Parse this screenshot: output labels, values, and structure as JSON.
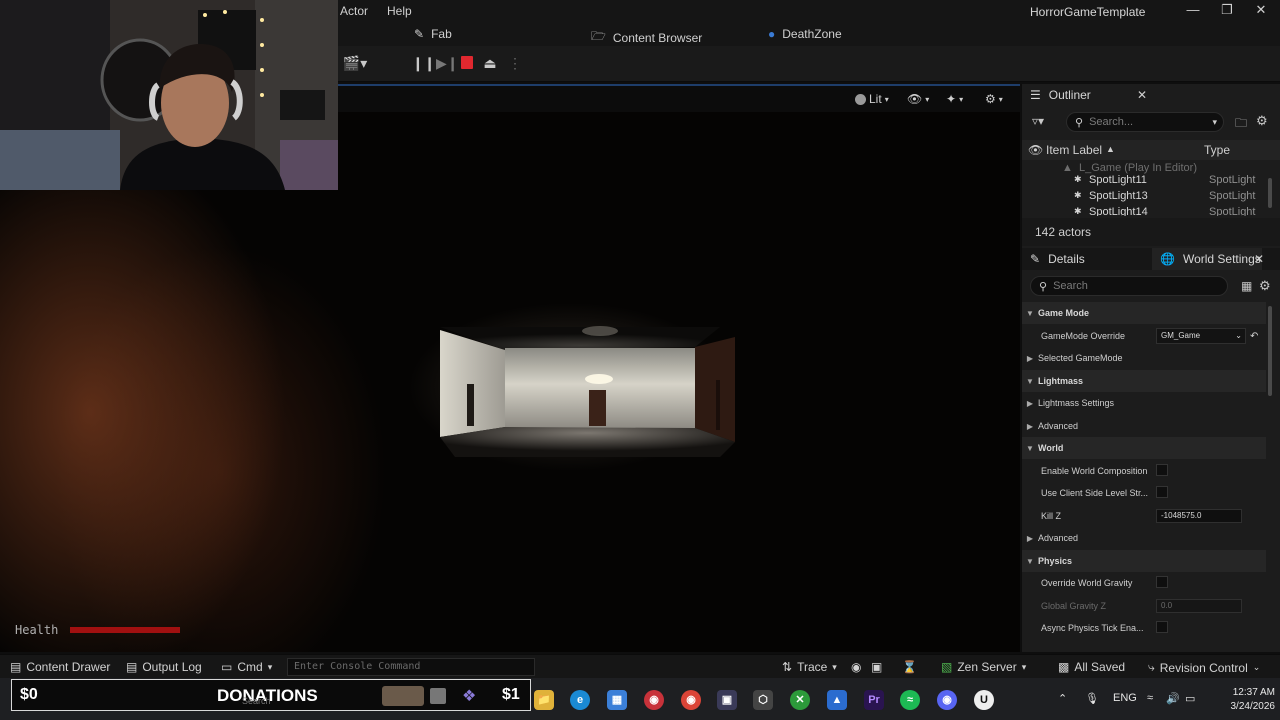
{
  "menu": {
    "actor": "Actor",
    "help": "Help",
    "project": "HorrorGameTemplate"
  },
  "tabs": {
    "fab": "Fab",
    "content_browser": "Content Browser",
    "deathzone": "DeathZone"
  },
  "viewport": {
    "lit": "Lit",
    "health_label": "Health",
    "health_fraction": 1.0
  },
  "outliner": {
    "title": "Outliner",
    "search_placeholder": "Search...",
    "col_label": "Item Label",
    "col_type": "Type",
    "rows": [
      {
        "label": "L_Game (Play In Editor)",
        "type": ""
      },
      {
        "label": "SpotLight11",
        "type": "SpotLight"
      },
      {
        "label": "SpotLight13",
        "type": "SpotLight"
      },
      {
        "label": "SpotLight14",
        "type": "SpotLight"
      }
    ],
    "actor_count": "142 actors"
  },
  "details": {
    "tab_details": "Details",
    "tab_world_settings": "World Settings",
    "search_placeholder": "Search",
    "sections": {
      "game_mode": "Game Mode",
      "gamemode_override": "GameMode Override",
      "gamemode_value": "GM_Game",
      "selected_gamemode": "Selected GameMode",
      "lightmass": "Lightmass",
      "lightmass_settings": "Lightmass Settings",
      "advanced": "Advanced",
      "world": "World",
      "enable_world_composition": "Enable World Composition",
      "use_client_side": "Use Client Side Level Str...",
      "kill_z": "Kill Z",
      "kill_z_value": "-1048575.0",
      "physics": "Physics",
      "override_gravity": "Override World Gravity",
      "global_gravity_z": "Global Gravity Z",
      "global_gravity_value": "0.0",
      "async_physics": "Async Physics Tick Ena..."
    }
  },
  "statusbar": {
    "content_drawer": "Content Drawer",
    "output_log": "Output Log",
    "cmd": "Cmd",
    "console_placeholder": "Enter Console Command",
    "trace": "Trace",
    "zen_server": "Zen Server",
    "all_saved": "All Saved",
    "revision_control": "Revision Control"
  },
  "taskbar": {
    "donation_left": "$0",
    "donation_title": "DONATIONS",
    "donation_right": "$1",
    "search": "Search",
    "lang": "ENG",
    "time": "12:37 AM",
    "date": "3/24/2026"
  }
}
